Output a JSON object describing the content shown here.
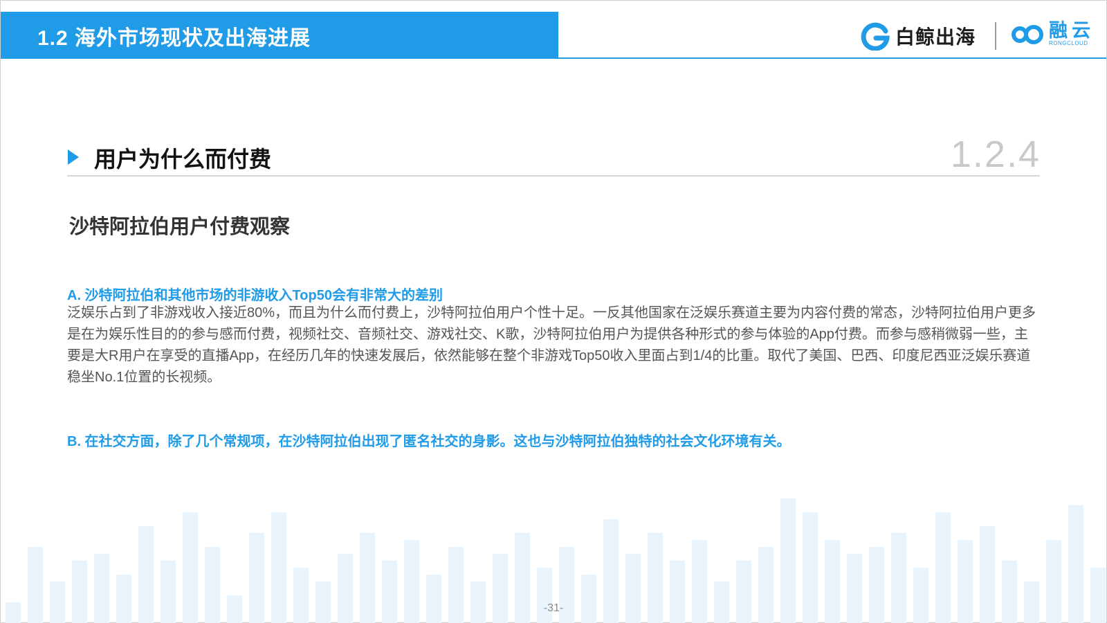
{
  "header": {
    "title": "1.2 海外市场现状及出海进展",
    "brand_a": "白鲸出海",
    "brand_b_cn": "融云",
    "brand_b_en": "RONGCLOUD"
  },
  "section": {
    "title": "用户为什么而付费",
    "number": "1.2.4"
  },
  "content": {
    "subtitle": "沙特阿拉伯用户付费观察",
    "point_a_title": "A. 沙特阿拉伯和其他市场的非游收入Top50会有非常大的差别",
    "point_a_body": "泛娱乐占到了非游戏收入接近80%，而且为什么而付费上，沙特阿拉伯用户个性十足。一反其他国家在泛娱乐赛道主要为内容付费的常态，沙特阿拉伯用户更多是在为娱乐性目的的参与感而付费，视频社交、音频社交、游戏社交、K歌，沙特阿拉伯用户为提供各种形式的参与体验的App付费。而参与感稍微弱一些，主要是大R用户在享受的直播App，在经历几年的快速发展后，依然能够在整个非游戏Top50收入里面占到1/4的比重。取代了美国、巴西、印度尼西亚泛娱乐赛道稳坐No.1位置的长视频。",
    "point_b": "B. 在社交方面，除了几个常规项，在沙特阿拉伯出现了匿名社交的身影。这也与沙特阿拉伯独特的社会文化环境有关。"
  },
  "footer": {
    "page_number": "-31-"
  },
  "colors": {
    "accent": "#1f9be8",
    "decor_bars": "#eaf4fc"
  },
  "icons": {
    "brand_a_logo": "whale-g-logo",
    "brand_b_logo": "rongcloud-infinity-logo",
    "section_marker": "triangle-right-icon"
  }
}
